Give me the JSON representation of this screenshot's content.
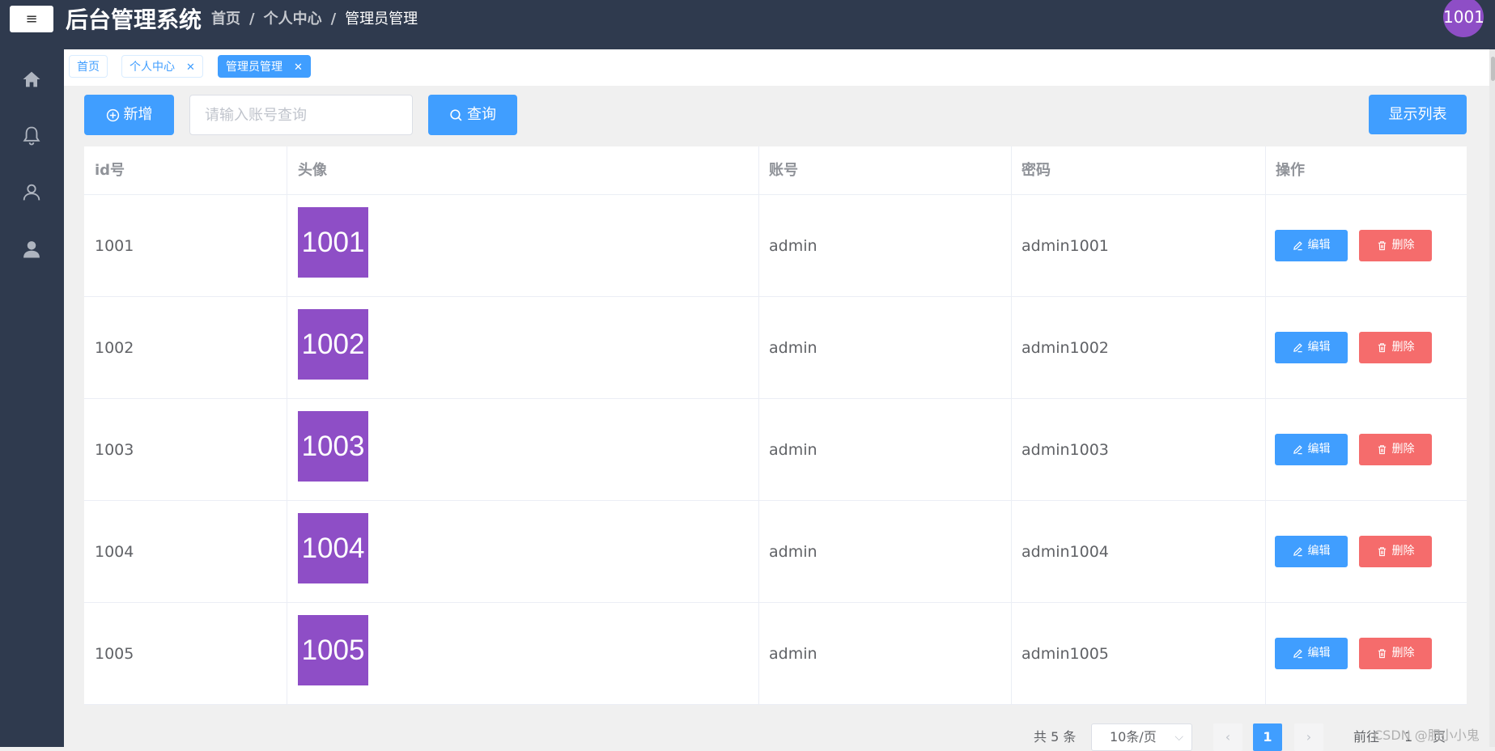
{
  "header": {
    "menu_icon": "≡",
    "app_title": "后台管理系统",
    "breadcrumbs": [
      "首页",
      "个人中心",
      "管理员管理"
    ],
    "user_avatar_text": "1001"
  },
  "sidebar": {
    "items": [
      {
        "icon": "home-icon"
      },
      {
        "icon": "bell-icon"
      },
      {
        "icon": "user-icon"
      },
      {
        "icon": "user-filled-icon"
      }
    ]
  },
  "tags": [
    {
      "label": "首页",
      "closable": false,
      "active": false
    },
    {
      "label": "个人中心",
      "closable": true,
      "active": false
    },
    {
      "label": "管理员管理",
      "closable": true,
      "active": true
    }
  ],
  "toolbar": {
    "add_label": "新增",
    "search_placeholder": "请输入账号查询",
    "search_label": "查询",
    "show_list_label": "显示列表"
  },
  "table": {
    "columns": [
      "id号",
      "头像",
      "账号",
      "密码",
      "操作"
    ],
    "rows": [
      {
        "id": "1001",
        "avatar": "1001",
        "account": "admin",
        "password": "admin1001"
      },
      {
        "id": "1002",
        "avatar": "1002",
        "account": "admin",
        "password": "admin1002"
      },
      {
        "id": "1003",
        "avatar": "1003",
        "account": "admin",
        "password": "admin1003"
      },
      {
        "id": "1004",
        "avatar": "1004",
        "account": "admin",
        "password": "admin1004"
      },
      {
        "id": "1005",
        "avatar": "1005",
        "account": "admin",
        "password": "admin1005"
      }
    ],
    "edit_label": "编辑",
    "delete_label": "删除"
  },
  "pagination": {
    "total_text": "共 5 条",
    "page_size": "10条/页",
    "current_page": "1",
    "goto_label": "前往",
    "goto_value": "1",
    "page_unit": "页"
  },
  "watermark": "CSDN @胆小小鬼",
  "colors": {
    "header_bg": "#2f3a4e",
    "primary": "#409eff",
    "danger": "#f56c6c",
    "avatar": "#8e4ec6"
  }
}
